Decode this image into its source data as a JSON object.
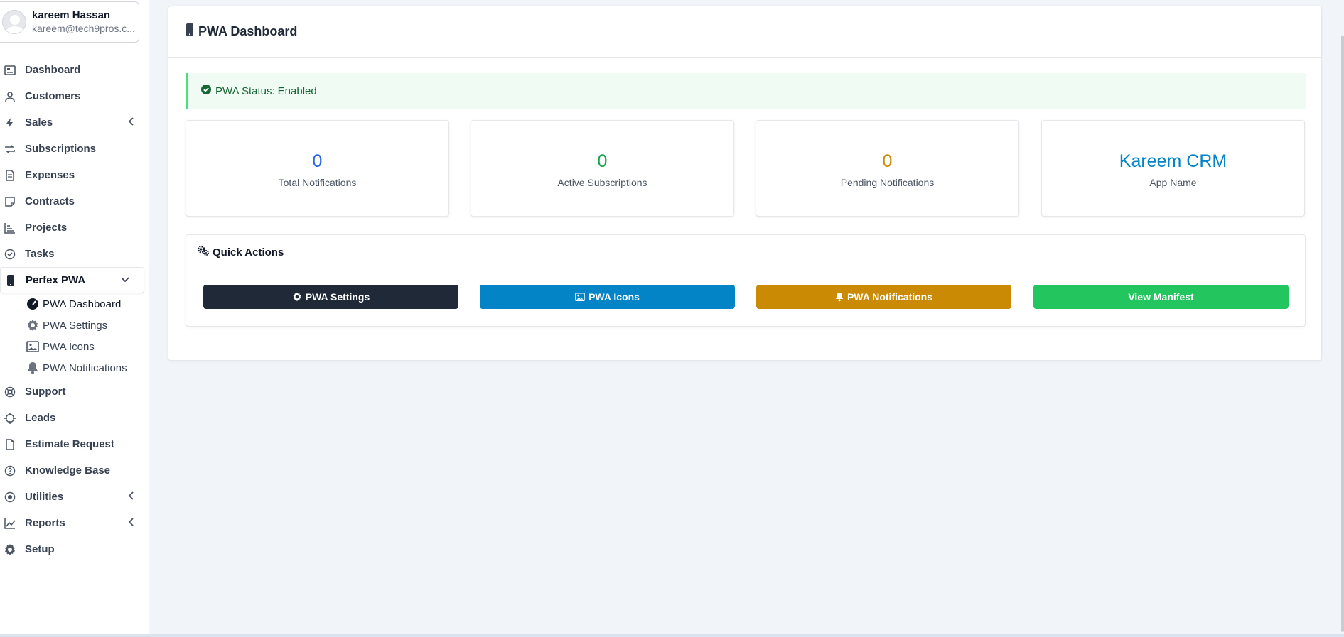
{
  "user": {
    "name": "kareem Hassan",
    "email": "kareem@tech9pros.c..."
  },
  "sidebar": {
    "items": [
      {
        "label": "Dashboard",
        "icon": "dashboard-icon"
      },
      {
        "label": "Customers",
        "icon": "user-icon"
      },
      {
        "label": "Sales",
        "icon": "bolt-icon",
        "expandable": true
      },
      {
        "label": "Subscriptions",
        "icon": "repeat-icon"
      },
      {
        "label": "Expenses",
        "icon": "file-text-icon"
      },
      {
        "label": "Contracts",
        "icon": "sticky-note-icon"
      },
      {
        "label": "Projects",
        "icon": "bar-chart-icon"
      },
      {
        "label": "Tasks",
        "icon": "check-circle-icon"
      },
      {
        "label": "Perfex PWA",
        "icon": "mobile-icon",
        "expanded": true
      },
      {
        "label": "Support",
        "icon": "life-ring-icon"
      },
      {
        "label": "Leads",
        "icon": "crosshair-icon"
      },
      {
        "label": "Estimate Request",
        "icon": "file-icon"
      },
      {
        "label": "Knowledge Base",
        "icon": "question-circle-icon"
      },
      {
        "label": "Utilities",
        "icon": "dot-circle-icon",
        "expandable": true
      },
      {
        "label": "Reports",
        "icon": "line-chart-icon",
        "expandable": true
      },
      {
        "label": "Setup",
        "icon": "gear-icon"
      }
    ],
    "submenu": [
      {
        "label": "PWA Dashboard",
        "icon": "gauge-icon",
        "current": true
      },
      {
        "label": "PWA Settings",
        "icon": "gear-icon"
      },
      {
        "label": "PWA Icons",
        "icon": "image-icon"
      },
      {
        "label": "PWA Notifications",
        "icon": "bell-icon"
      }
    ]
  },
  "main": {
    "title": "PWA Dashboard",
    "status": {
      "label": "PWA Status:",
      "value": "Enabled"
    },
    "stats": [
      {
        "value": "0",
        "caption": "Total Notifications",
        "color": "#2563eb"
      },
      {
        "value": "0",
        "caption": "Active Subscriptions",
        "color": "#16a34a"
      },
      {
        "value": "0",
        "caption": "Pending Notifications",
        "color": "#ca8a04"
      },
      {
        "value": "Kareem CRM",
        "caption": "App Name",
        "color": "#0284c7"
      }
    ],
    "quick_actions": {
      "title": "Quick Actions",
      "buttons": [
        {
          "label": "PWA Settings",
          "icon": "gear-icon",
          "color": "#1f2937"
        },
        {
          "label": "PWA Icons",
          "icon": "image-icon",
          "color": "#0284c7"
        },
        {
          "label": "PWA Notifications",
          "icon": "bell-icon",
          "color": "#ca8a04"
        },
        {
          "label": "View Manifest",
          "icon": "",
          "color": "#22c55e"
        }
      ]
    }
  }
}
